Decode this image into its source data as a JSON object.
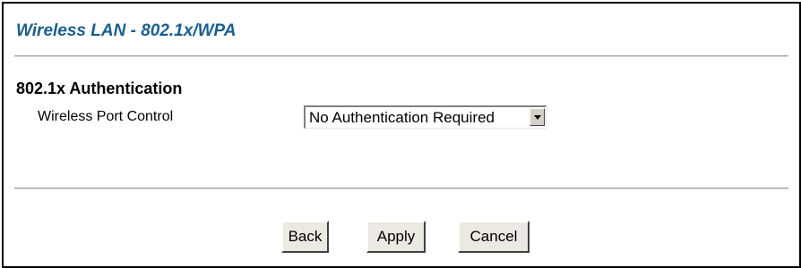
{
  "header": {
    "title": "Wireless LAN - 802.1x/WPA",
    "title_color": "#1a5e8e"
  },
  "section": {
    "heading": "802.1x Authentication",
    "port_control": {
      "label": "Wireless Port Control",
      "selected_value": "No Authentication Required",
      "arrow_icon": "chevron-down-icon"
    }
  },
  "buttons": {
    "back_label": "Back",
    "apply_label": "Apply",
    "cancel_label": "Cancel"
  }
}
